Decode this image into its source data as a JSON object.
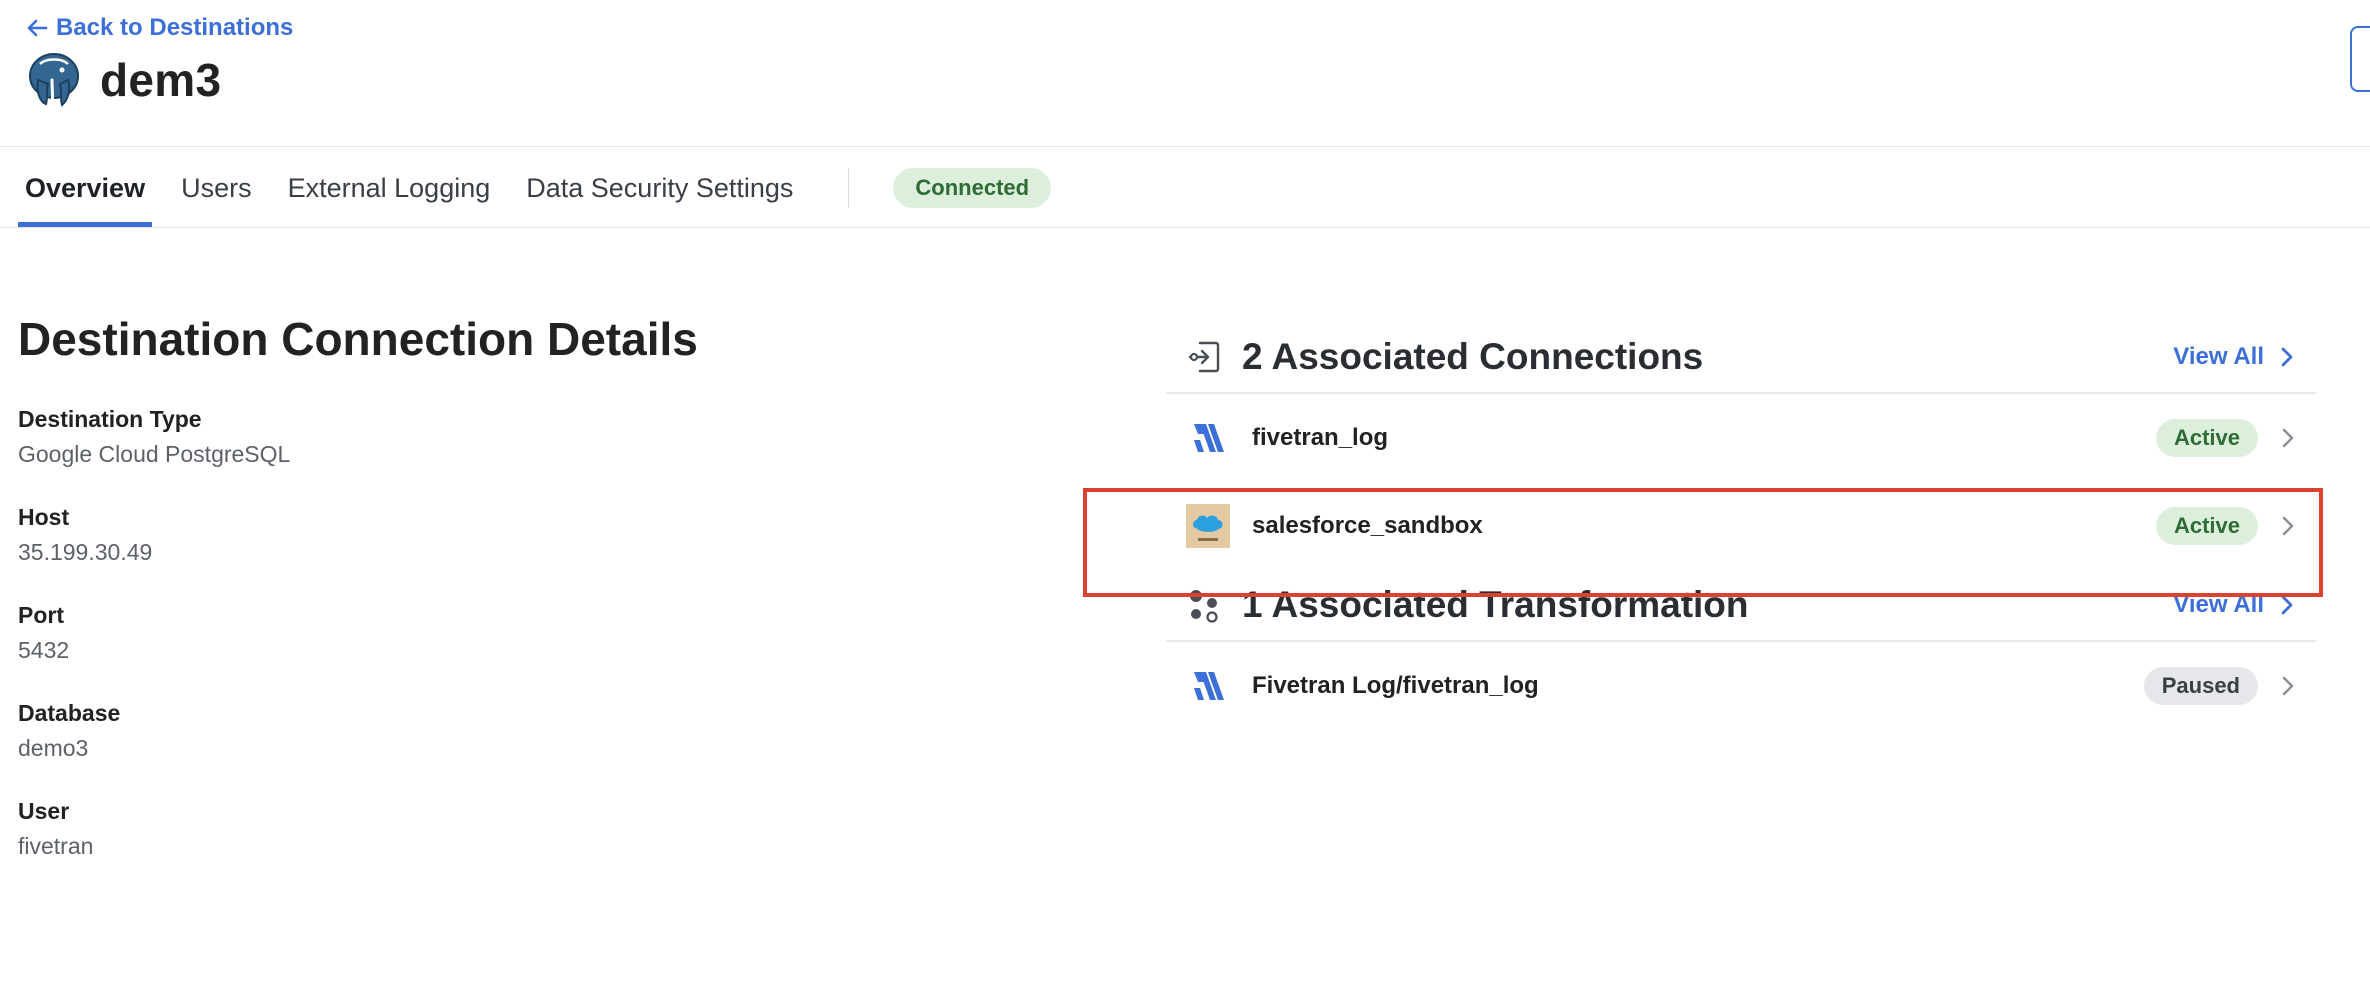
{
  "header": {
    "back_label": "Back to Destinations",
    "title": "dem3",
    "logo_icon": "postgresql-elephant-icon"
  },
  "tabs": [
    {
      "label": "Overview",
      "active": true
    },
    {
      "label": "Users",
      "active": false
    },
    {
      "label": "External Logging",
      "active": false
    },
    {
      "label": "Data Security Settings",
      "active": false
    }
  ],
  "status": "Connected",
  "details": {
    "heading": "Destination Connection Details",
    "fields": [
      {
        "label": "Destination Type",
        "value": "Google Cloud PostgreSQL"
      },
      {
        "label": "Host",
        "value": "35.199.30.49"
      },
      {
        "label": "Port",
        "value": "5432"
      },
      {
        "label": "Database",
        "value": "demo3"
      },
      {
        "label": "User",
        "value": "fivetran"
      }
    ]
  },
  "connections": {
    "title": "2 Associated Connections",
    "view_all": "View All",
    "items": [
      {
        "name": "fivetran_log",
        "status": "Active",
        "icon": "fivetran-logo-icon"
      },
      {
        "name": "salesforce_sandbox",
        "status": "Active",
        "icon": "salesforce-sandbox-icon"
      }
    ]
  },
  "transformations": {
    "title": "1 Associated Transformation",
    "view_all": "View All",
    "items": [
      {
        "name": "Fivetran Log/fivetran_log",
        "status": "Paused",
        "icon": "fivetran-logo-icon"
      }
    ]
  },
  "colors": {
    "accent": "#3d6fd9",
    "active_bg": "#dcefdc",
    "active_fg": "#2f6b35",
    "highlight": "#d9432f"
  }
}
